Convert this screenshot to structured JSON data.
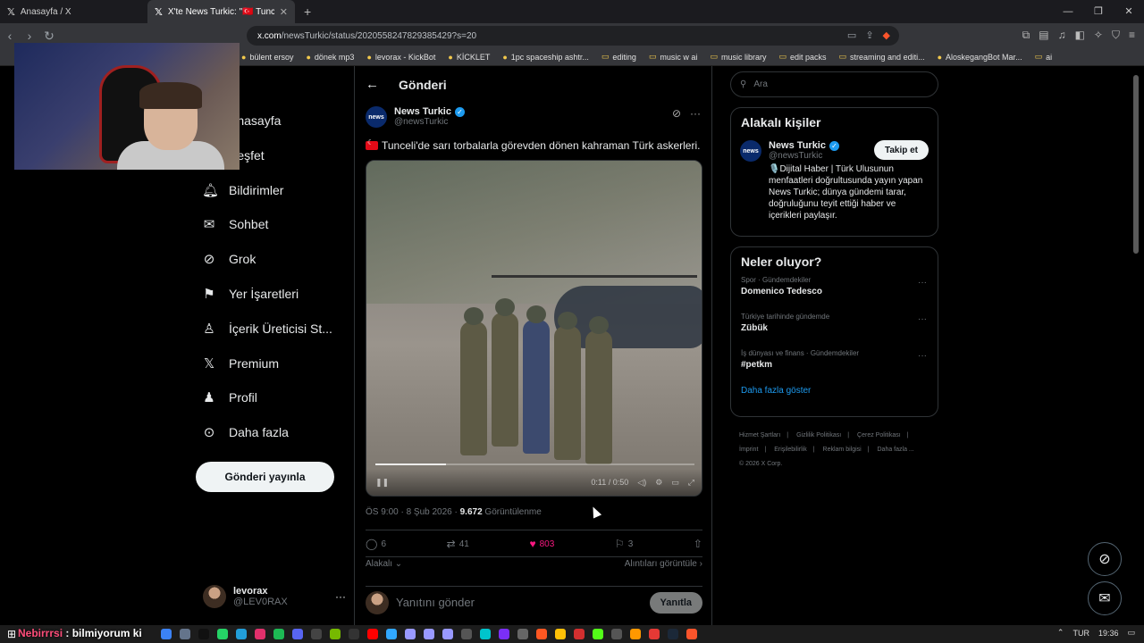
{
  "browser": {
    "tabs": [
      {
        "label": "Anasayfa / X",
        "active": false
      },
      {
        "label": "X'te News Turkic: \"🇹🇷 Tunceli'de",
        "active": true
      }
    ],
    "url_host": "x.com",
    "url_path": "/newsTurkic/status/2020558247829385429?s=20",
    "bookmarks": [
      "bülent ersoy",
      "dönek mp3",
      "levorax - KickBot",
      "KİCKLET",
      "1pc spaceship ashtr...",
      "editing",
      "music w ai",
      "music library",
      "edit packs",
      "streaming and editi...",
      "AloskegangBot Mar...",
      "ai"
    ]
  },
  "nav": {
    "items": [
      {
        "label": "Anasayfa",
        "icon": "home-icon"
      },
      {
        "label": "Keşfet",
        "icon": "search-icon"
      },
      {
        "label": "Bildirimler",
        "icon": "bell-icon"
      },
      {
        "label": "Sohbet",
        "icon": "mail-icon"
      },
      {
        "label": "Grok",
        "icon": "grok-icon"
      },
      {
        "label": "Yer İşaretleri",
        "icon": "bookmark-icon"
      },
      {
        "label": "İçerik Üreticisi St...",
        "icon": "creator-icon"
      },
      {
        "label": "Premium",
        "icon": "x-icon"
      },
      {
        "label": "Profil",
        "icon": "profile-icon"
      },
      {
        "label": "Daha fazla",
        "icon": "more-icon"
      }
    ],
    "post_button": "Gönderi yayınla",
    "account_name": "levorax",
    "account_handle": "@LEV0RAX"
  },
  "post": {
    "header": "Gönderi",
    "author_name": "News Turkic",
    "author_handle": "@newsTurkic",
    "logo_text": "news",
    "text": "Tunceli'de sarı torbalarla görevden dönen kahraman Türk askerleri.",
    "video_time": "0:11 / 0:50",
    "video_progress": 0.22,
    "timestamp": "ÖS 9:00 · 8 Şub 2026 · ",
    "views": "9.672",
    "views_label": " Görüntülenme",
    "replies": "6",
    "reposts": "41",
    "likes": "803",
    "bookmarks": "3",
    "relevance": "Alakalı",
    "quotes": "Alıntıları görüntüle",
    "reply_placeholder": "Yanıtını gönder",
    "reply_button": "Yanıtla"
  },
  "sidebar": {
    "search_placeholder": "Ara",
    "related_title": "Alakalı kişiler",
    "related_name": "News Turkic",
    "related_handle": "@newsTurkic",
    "follow_button": "Takip et",
    "related_bio": "🎙️Dijital Haber | Türk Ulusunun menfaatleri doğrultusunda yayın yapan News Turkic; dünya gündemi tarar, doğruluğunu teyit ettiği haber ve içerikleri paylaşır.",
    "trends_title": "Neler oluyor?",
    "trends": [
      {
        "category": "Spor · Gündemdekiler",
        "name": "Domenico Tedesco"
      },
      {
        "category": "Türkiye tarihinde gündemde",
        "name": "Zübük"
      },
      {
        "category": "İş dünyası ve finans · Gündemdekiler",
        "name": "#petkm"
      }
    ],
    "show_more": "Daha fazla göster",
    "footer": [
      "Hizmet Şartları",
      "|",
      "Gizlilik Politikası",
      "|",
      "Çerez Politikası",
      "|",
      "İmprint",
      "|",
      "Erişilebilirlik",
      "|",
      "Reklam bilgisi",
      "|",
      "Daha fazla ...",
      "© 2026 X Corp."
    ]
  },
  "taskbar": {
    "chat_user": "Nebirrrsi",
    "chat_message": " : bilmiyorum ki",
    "language": "TUR",
    "time": "19:36"
  }
}
